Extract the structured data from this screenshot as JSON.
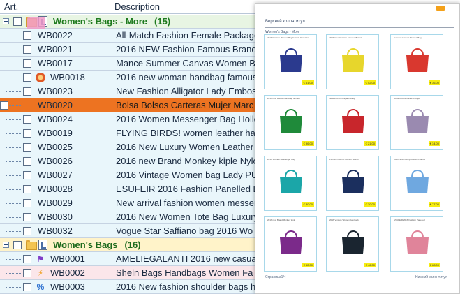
{
  "columns": {
    "art": "Art.",
    "description": "Description"
  },
  "groups": [
    {
      "title": "Women's Bags - More",
      "count": "(15)"
    },
    {
      "title": "Women's Bags",
      "count": "(16)"
    }
  ],
  "items": [
    {
      "art": "WB0022",
      "desc": "All-Match Fashion Female Package"
    },
    {
      "art": "WB0021",
      "desc": "2016 NEW Fashion Famous Brand"
    },
    {
      "art": "WB0017",
      "desc": "Mance Summer Canvas Women B"
    },
    {
      "art": "WB0018",
      "desc": "2016 new woman handbag famous"
    },
    {
      "art": "WB0023",
      "desc": "New Fashion Alligator Lady Embos"
    },
    {
      "art": "WB0020",
      "desc": "Bolsa Bolsos Carteras Mujer Marc"
    },
    {
      "art": "WB0024",
      "desc": "2016 Women Messenger Bag Hollo"
    },
    {
      "art": "WB0019",
      "desc": "FLYING BIRDS! women leather han"
    },
    {
      "art": "WB0025",
      "desc": "2016 New Luxury Women Leather"
    },
    {
      "art": "WB0026",
      "desc": "2016 new Brand Monkey kiple Nylo"
    },
    {
      "art": "WB0027",
      "desc": "2016 Vintage Women bag Lady PU"
    },
    {
      "art": "WB0028",
      "desc": "ESUFEIR 2016 Fashion Panelled L"
    },
    {
      "art": "WB0029",
      "desc": "New arrival fashion women messer"
    },
    {
      "art": "WB0030",
      "desc": "2016 New Women Tote Bag Luxury"
    },
    {
      "art": "WB0032",
      "desc": "Vogue Star Saffiano bag 2016 Wo"
    },
    {
      "art": "WB0001",
      "desc": "AMELIEGALANTI 2016 new casua"
    },
    {
      "art": "WB0002",
      "desc": "Sheln Bags Handbags Women Fa"
    },
    {
      "art": "WB0003",
      "desc": "2016 New fashion shoulder bags h"
    }
  ],
  "preview": {
    "header": "Верхний колонтитул",
    "subheader": "Women's Bags - More",
    "footer_left": "Страница1/4",
    "footer_right": "Нижний колонтитул",
    "cards": [
      {
        "caption": "2016 Fashion Women Bag Female Shoulder",
        "price": "€ 61.00",
        "color": "#2b3a8e"
      },
      {
        "caption": "2016 New Fashion Famous Brand",
        "price": "€ 52.00",
        "color": "#e7d62c"
      },
      {
        "caption": "Summer Canvas Women Bag",
        "price": "€ 36.00",
        "color": "#d9382f"
      },
      {
        "caption": "2016 new woman handbag famous",
        "price": "€ 96.00",
        "color": "#1f8a3a"
      },
      {
        "caption": "New Fashion Alligator Lady",
        "price": "€ 21.00",
        "color": "#c8262c"
      },
      {
        "caption": "Bolsa Bolsos Carteras Mujer",
        "price": "€ 34.00",
        "color": "#9a8ab0"
      },
      {
        "caption": "2016 Women Messenger Bag",
        "price": "€ 30.00",
        "color": "#1ba6a8"
      },
      {
        "caption": "FLYING BIRDS! women leather",
        "price": "€ 30.00",
        "color": "#1b2f5e"
      },
      {
        "caption": "2016 New Luxury Women Leather",
        "price": "€ 77.00",
        "color": "#6fa8e0"
      },
      {
        "caption": "2016 new Brand Monkey kiple",
        "price": "€ 52.00",
        "color": "#7b2a8a"
      },
      {
        "caption": "2016 Vintage Women bag Lady",
        "price": "€ 46.00",
        "color": "#1a2530"
      },
      {
        "caption": "ESUFEIR 2016 Fashion Panelled",
        "price": "€ 68.00",
        "color": "#e0849a"
      }
    ]
  }
}
